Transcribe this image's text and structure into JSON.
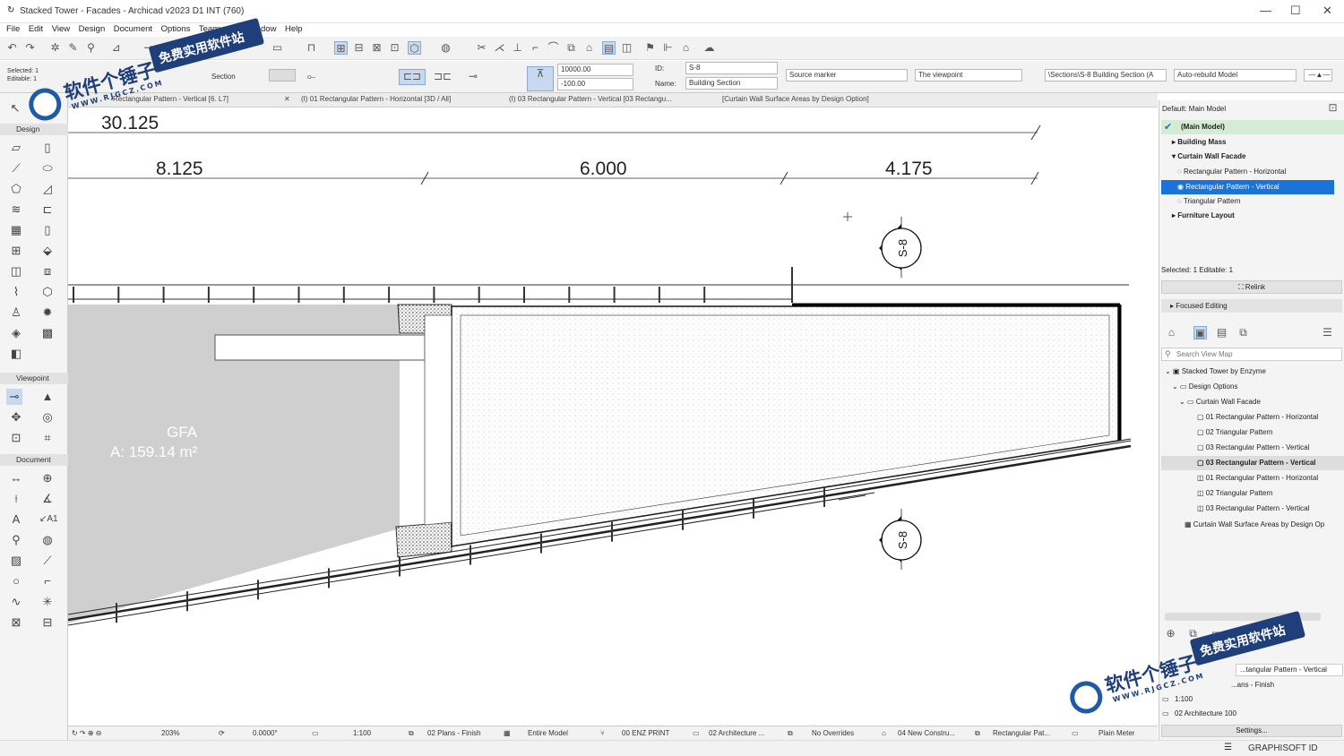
{
  "window": {
    "title": "Stacked Tower - Facades - Archicad v2023 D1 INT (760)"
  },
  "menu": [
    "File",
    "Edit",
    "View",
    "Design",
    "Document",
    "Options",
    "Teamwork",
    "Window",
    "Help"
  ],
  "infobox": {
    "selected": "Selected: 1",
    "editable": "Editable: 1",
    "name_label": "Section",
    "range_top": "10000.00",
    "range_bottom": "-100.00",
    "id_label": "ID:",
    "id_value": "S-8",
    "name_field_label": "Name:",
    "name_value": "Building Section",
    "marker": "Source marker",
    "viewpoint": "The viewpoint",
    "path": "\\Sections\\S-8 Building Section (A",
    "rebuild": "Auto-rebuild Model"
  },
  "tabs": [
    "Rectangular Pattern - Vertical [6. L7]",
    "(I) 01 Rectangular Pattern - Horizontal [3D / All]",
    "(I) 03 Rectangular Pattern - Vertical [03 Rectangu...",
    "[Curtain Wall Surface Areas by Design Option]"
  ],
  "toolbox": {
    "design": "Design",
    "viewpoint": "Viewpoint",
    "document": "Document"
  },
  "drawing": {
    "dim_total": "30.125",
    "dim_a": "8.125",
    "dim_b": "6.000",
    "dim_c": "4.175",
    "zone_name": "GFA",
    "zone_area": "A: 159.14 m²",
    "marker_label": "S-8"
  },
  "design_options": {
    "default": "Default: Main Model",
    "main": "(Main Model)",
    "items": [
      "Building Mass",
      "Curtain Wall Facade",
      "Rectangular Pattern - Horizontal",
      "Rectangular Pattern - Vertical",
      "Triangular Pattern",
      "Furniture Layout"
    ],
    "selected": "Selected: 1 Editable: 1",
    "relink": "Relink",
    "focused": "Focused Editing"
  },
  "navigator": {
    "search": "Search View Map",
    "root": "Stacked Tower by Enzyme",
    "folder1": "Design Options",
    "folder2": "Curtain Wall Facade",
    "views": [
      "01 Rectangular Pattern - Horizontal",
      "02 Triangular Pattern",
      "03 Rectangular Pattern - Vertical",
      "03 Rectangular Pattern - Vertical",
      "01 Rectangular Pattern - Horizontal",
      "02 Triangular Pattern",
      "03 Rectangular Pattern - Vertical",
      "Curtain Wall Surface Areas by Design Op"
    ]
  },
  "properties": {
    "view_name": "...tangular Pattern - Vertical",
    "layer": "...ans - Finish",
    "scale": "1:100",
    "pen": "02 Architecture 100",
    "settings": "Settings..."
  },
  "status": {
    "zoom": "203%",
    "angle": "0.0000°",
    "scale": "1:100",
    "layer": "02 Plans - Finish",
    "model": "Entire Model",
    "pen": "00 ENZ PRINT",
    "graphic": "02 Architecture ...",
    "overrides": "No Overrides",
    "reno": "04 New Constru...",
    "option": "Rectangular Pat...",
    "units": "Plain Meter"
  },
  "footer": {
    "brand": "GRAPHISOFT ID"
  },
  "watermark": {
    "cn": "软件个锤子",
    "slogan": "免费实用软件站",
    "url": "WWW.RJGCZ.COM"
  }
}
